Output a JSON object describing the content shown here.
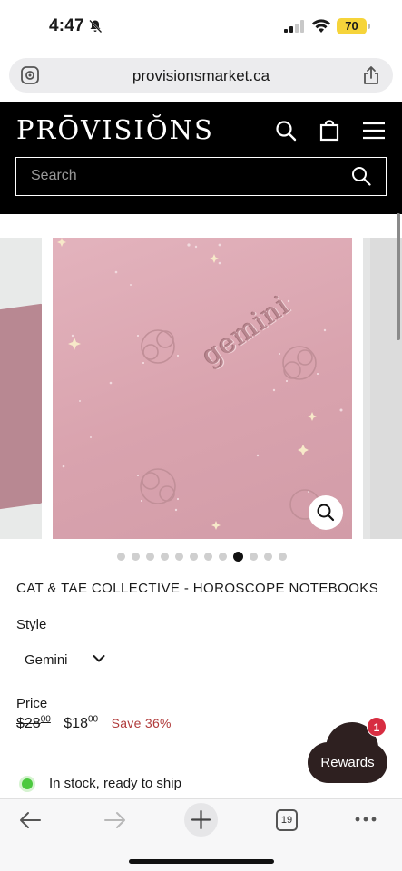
{
  "status_bar": {
    "time": "4:47",
    "battery": "70"
  },
  "browser": {
    "url": "provisionsmarket.ca",
    "open_tabs": "19"
  },
  "site": {
    "logo": "PRŌVISIŎNS",
    "search_placeholder": "Search"
  },
  "carousel": {
    "image_text": "gemini",
    "slide_count": 12,
    "active_index": 8
  },
  "product": {
    "title": "CAT & TAE COLLECTIVE - HOROSCOPE NOTEBOOKS",
    "style_label": "Style",
    "style_value": "Gemini",
    "price_label": "Price",
    "price_old": "$28",
    "price_old_cents": "00",
    "price_new": "$18",
    "price_new_cents": "00",
    "save_text": "Save 36%",
    "stock_text": "In stock, ready to ship"
  },
  "rewards": {
    "label": "Rewards",
    "badge": "1"
  },
  "colors": {
    "header_bg": "#000000",
    "save_red": "#b03a3a",
    "stock_green": "#4cc93f",
    "rewards_bg": "#2e2020",
    "badge_red": "#d72d41",
    "battery_yellow": "#f6d43a"
  }
}
